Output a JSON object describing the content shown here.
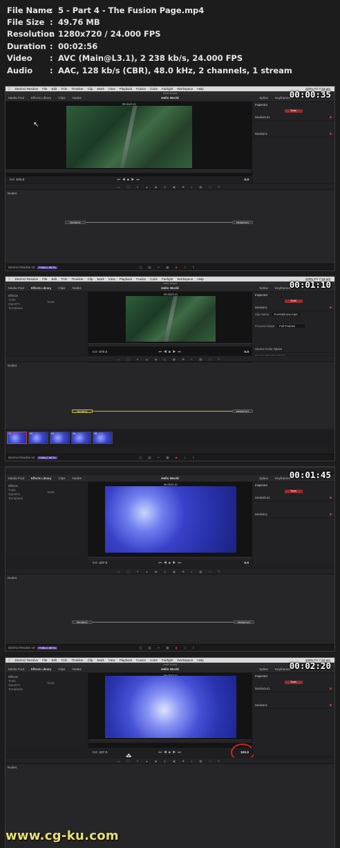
{
  "media_info": [
    {
      "key": "File Name",
      "value": "5 - Part 4 - The Fusion Page.mp4"
    },
    {
      "key": "File Size",
      "value": "49.76 MB"
    },
    {
      "key": "Resolution",
      "value": "1280x720 / 24.000 FPS"
    },
    {
      "key": "Duration",
      "value": "00:02:56"
    },
    {
      "key": "Video",
      "value": "AVC (Main@L3.1), 2 238 kb/s, 24.000 FPS"
    },
    {
      "key": "Audio",
      "value": "AAC, 128 kb/s (CBR), 48.0 kHz, 2 channels, 1 stream"
    }
  ],
  "colon": ":",
  "app": {
    "menubar": {
      "apple": "",
      "items": [
        "DaVinci Resolve",
        "File",
        "Edit",
        "Trim",
        "Timeline",
        "Clip",
        "Mark",
        "View",
        "Playback",
        "Fusion",
        "Color",
        "Fairlight",
        "Workspace",
        "Help"
      ],
      "clock": "100%  Fri 7:16 pm"
    },
    "window_title": "Hello World",
    "project_title": "Hello World",
    "top_tabs": [
      "Media Pool",
      "Effects Library",
      "Clips",
      "Nodes"
    ],
    "top_right": [
      "Spline",
      "Keyframes"
    ],
    "inspector_label": "Inspector",
    "inspector_tab": "Tools",
    "viewer_label": "MediaOut1",
    "nodes_label": "Nodes",
    "node_in": "MediaIn1",
    "node_out": "MediaOut1",
    "status": {
      "name": "DaVinci Resolve 16",
      "beta": "PUBLIC BETA",
      "pages": [
        "◫",
        "▤",
        "✂",
        "▦",
        "◈",
        "♫",
        "⇪"
      ]
    }
  },
  "frames": [
    {
      "timecode": "00:00:35",
      "left_tc": "0.0",
      "left_tc2": "570.0",
      "right_tc": "0.0"
    },
    {
      "timecode": "00:01:10",
      "left_tc": "0.0",
      "left_tc2": "570.0",
      "right_tc": "0.0"
    },
    {
      "timecode": "00:01:45",
      "left_tc": "0.0",
      "left_tc2": "237.0",
      "right_tc": "0.0"
    },
    {
      "timecode": "00:02:20",
      "left_tc": "0.0",
      "left_tc2": "237.0",
      "right_tc": "100.0"
    }
  ],
  "effects_panel": {
    "title": "Effects",
    "items": [
      "Tools",
      "OpenFX",
      "Templates"
    ],
    "category": "Tools"
  },
  "inspector_frame2": {
    "node": "MediaIn1",
    "clip_name_label": "Clip Name",
    "clip_name": "ForestDrone.mp4",
    "process_mode_label": "Process Mode",
    "process_mode": "Full Frames",
    "source_color_space": "Source Color Space",
    "source_gamma_space": "Source Gamma Space"
  },
  "thumbnails": [
    "01",
    "02",
    "03",
    "04",
    "05"
  ],
  "watermark": "www.cg-ku.com"
}
